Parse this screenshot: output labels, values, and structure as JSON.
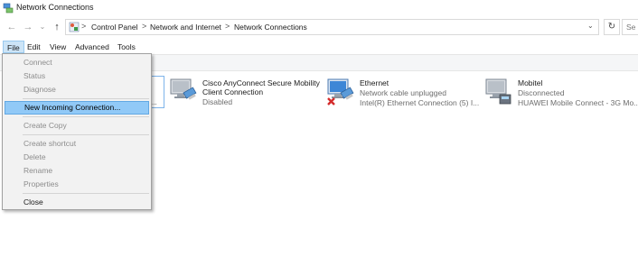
{
  "window": {
    "title": "Network Connections",
    "icon": "network-connections-icon"
  },
  "address": {
    "back_icon": "←",
    "forward_icon": "→",
    "recent_icon": "⌄",
    "up_icon": "↑",
    "breadcrumb": [
      "Control Panel",
      "Network and Internet",
      "Network Connections"
    ],
    "separator": ">",
    "dropdown_icon": "⌄",
    "refresh_icon": "↻",
    "search_placeholder": "Se"
  },
  "menu": {
    "items": [
      "File",
      "Edit",
      "View",
      "Advanced",
      "Tools"
    ]
  },
  "file_menu": {
    "items": [
      {
        "label": "Connect",
        "enabled": false
      },
      {
        "label": "Status",
        "enabled": false
      },
      {
        "label": "Diagnose",
        "enabled": false
      },
      {
        "label": "New Incoming Connection...",
        "enabled": true,
        "highlighted": true
      },
      {
        "label": "Create Copy",
        "enabled": false
      },
      {
        "label": "Create shortcut",
        "enabled": false
      },
      {
        "label": "Delete",
        "enabled": false
      },
      {
        "label": "Rename",
        "enabled": false
      },
      {
        "label": "Properties",
        "enabled": false
      },
      {
        "label": "Close",
        "enabled": true
      }
    ]
  },
  "connections": [
    {
      "name": "Cisco AnyConnect Secure Mobility",
      "name_line2": "Client Connection",
      "status": "Disabled",
      "device": "",
      "icon": "network-adapter-icon"
    },
    {
      "name": "Ethernet",
      "status": "Network cable unplugged",
      "device": "Intel(R) Ethernet Connection (5) I...",
      "icon": "ethernet-adapter-icon"
    },
    {
      "name": "Mobitel",
      "status": "Disconnected",
      "device": "HUAWEI Mobile Connect - 3G Mo...",
      "icon": "mobile-broadband-icon"
    }
  ],
  "partial_item_text": "...",
  "colors": {
    "menu_highlight": "#91c9f7",
    "menu_open": "#cce4f7",
    "disabled_text": "#8c8c8c",
    "status_text": "#6d6d6d"
  }
}
